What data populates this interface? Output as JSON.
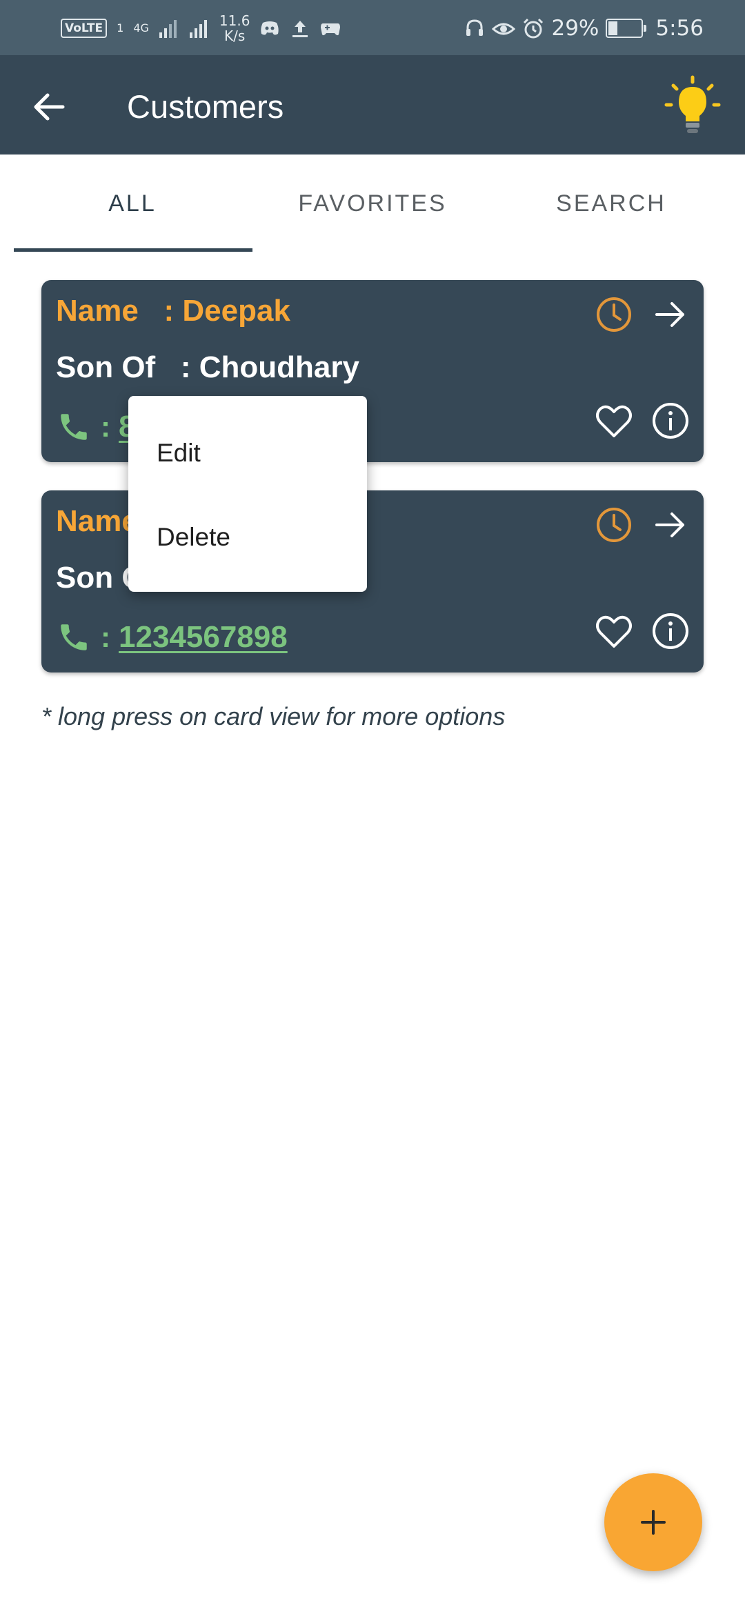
{
  "status_bar": {
    "volte": "VoLTE",
    "sim_slot": "1",
    "network": "4G",
    "speed_value": "11.6",
    "speed_unit": "K/s",
    "battery": "29%",
    "battery_level": 0.29,
    "time": "5:56",
    "icons": [
      "signal-icon",
      "discord-icon",
      "upload-icon",
      "game-icon",
      "headset-icon",
      "eye-icon",
      "alarm-icon",
      "battery-icon"
    ]
  },
  "app_bar": {
    "title": "Customers",
    "back_icon": "arrow-left-icon",
    "action_icon": "lightbulb-icon"
  },
  "tabs": [
    {
      "label": "ALL",
      "active": true
    },
    {
      "label": "FAVORITES",
      "active": false
    },
    {
      "label": "SEARCH",
      "active": false
    }
  ],
  "cards": [
    {
      "name_label": "Name   : Deepak",
      "son_label": "Son Of   : Choudhary",
      "phone_colon": ":",
      "phone": "8"
    },
    {
      "name_label": "Name",
      "son_label": "Son Of",
      "phone_colon": ":",
      "phone": "1234567898"
    }
  ],
  "context_menu": {
    "items": [
      "Edit",
      "Delete"
    ]
  },
  "hint": "* long press on card view for more options",
  "fab": {
    "icon": "plus-icon"
  },
  "colors": {
    "status_bar": "#4a5f6d",
    "app_bar": "#364856",
    "card": "#364856",
    "accent": "#f7a637",
    "phone": "#7cc47f",
    "fab": "#f9a633"
  }
}
